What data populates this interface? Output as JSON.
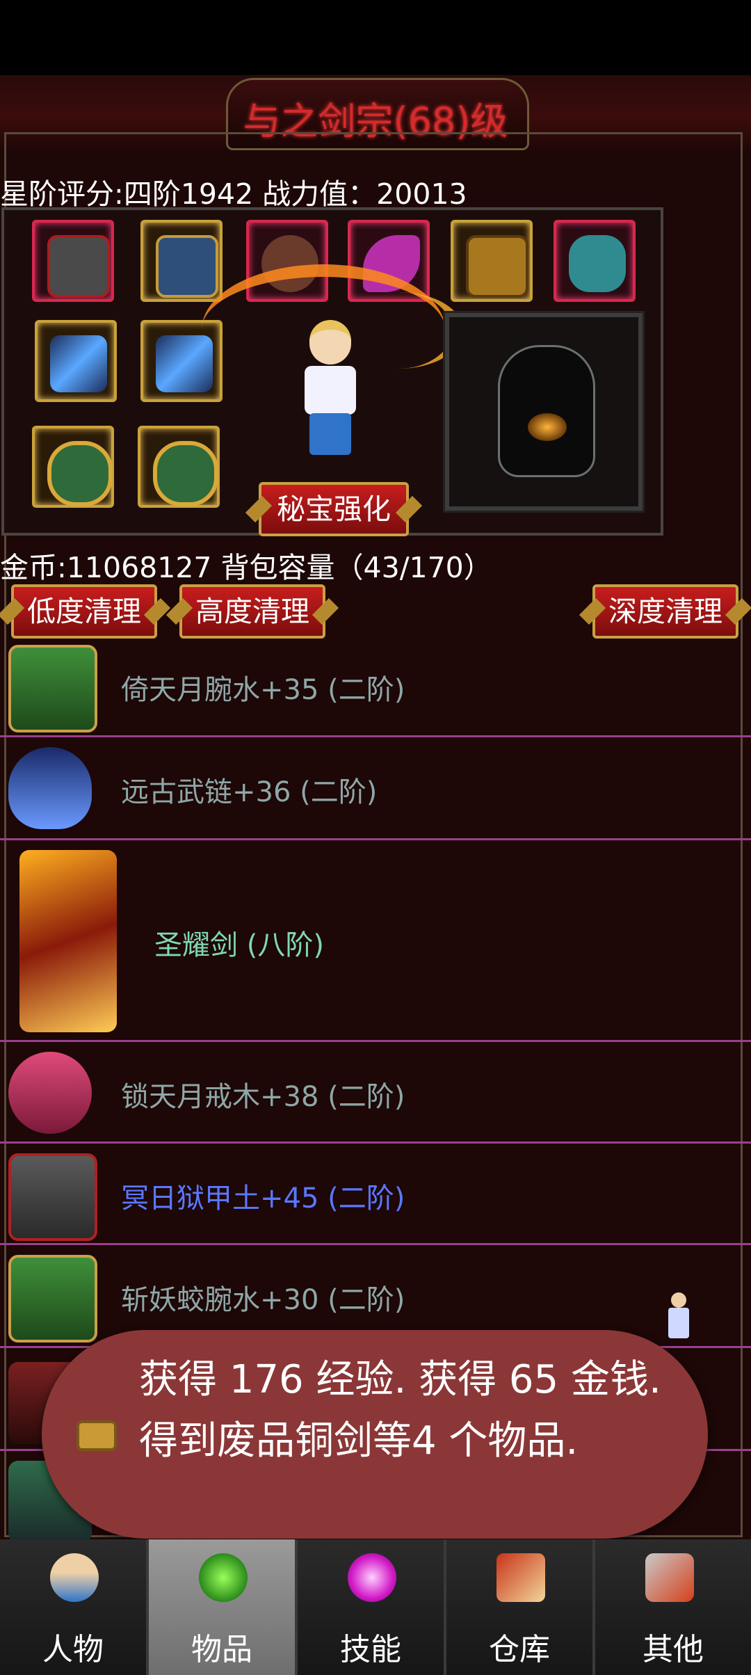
{
  "header": {
    "title": "与之剑宗(68)级",
    "star_rating_line": "星阶评分:四阶1942 战力值：20013"
  },
  "equipment": {
    "treasure_button": "秘宝强化",
    "slots": [
      {
        "icon": "helmet-icon"
      },
      {
        "icon": "armor-icon"
      },
      {
        "icon": "necklace-icon"
      },
      {
        "icon": "wing-icon"
      },
      {
        "icon": "boots-icon"
      },
      {
        "icon": "dragon-mount-icon"
      },
      {
        "icon": "sword-icon"
      },
      {
        "icon": "sword-icon"
      },
      {
        "icon": "ring-icon"
      },
      {
        "icon": "ring-icon"
      }
    ]
  },
  "inventory": {
    "gold_line": "金币:11068127 背包容量（43/170）",
    "clean_low": "低度清理",
    "clean_high": "高度清理",
    "clean_deep": "深度清理",
    "items": [
      {
        "name": "倚天月腕水+35 (二阶)",
        "color": "#8fa7a7",
        "icon": "bracer-icon"
      },
      {
        "name": "远古武链+36 (二阶)",
        "color": "#8fa7a7",
        "icon": "pendant-icon"
      },
      {
        "name": "圣耀剑 (八阶)",
        "color": "#7fd8b0",
        "icon": "flame-sword-icon"
      },
      {
        "name": "锁天月戒木+38 (二阶)",
        "color": "#8fa7a7",
        "icon": "ring-icon"
      },
      {
        "name": "冥日狱甲土+45 (二阶)",
        "color": "#5a78ff",
        "icon": "armor-icon"
      },
      {
        "name": "斩妖蛟腕水+30 (二阶)",
        "color": "#8fa7a7",
        "icon": "bracer-icon"
      }
    ]
  },
  "toast": {
    "message": "获得 176 经验. 获得 65 金钱. 得到废品铜剑等4 个物品.",
    "icon": "treasure-chest-icon"
  },
  "nav": {
    "tabs": [
      {
        "label": "人物",
        "icon": "character-icon"
      },
      {
        "label": "物品",
        "icon": "potion-icon"
      },
      {
        "label": "技能",
        "icon": "skill-orb-icon"
      },
      {
        "label": "仓库",
        "icon": "warehouse-icon"
      },
      {
        "label": "其他",
        "icon": "sword-shield-icon"
      }
    ],
    "active": "物品"
  }
}
